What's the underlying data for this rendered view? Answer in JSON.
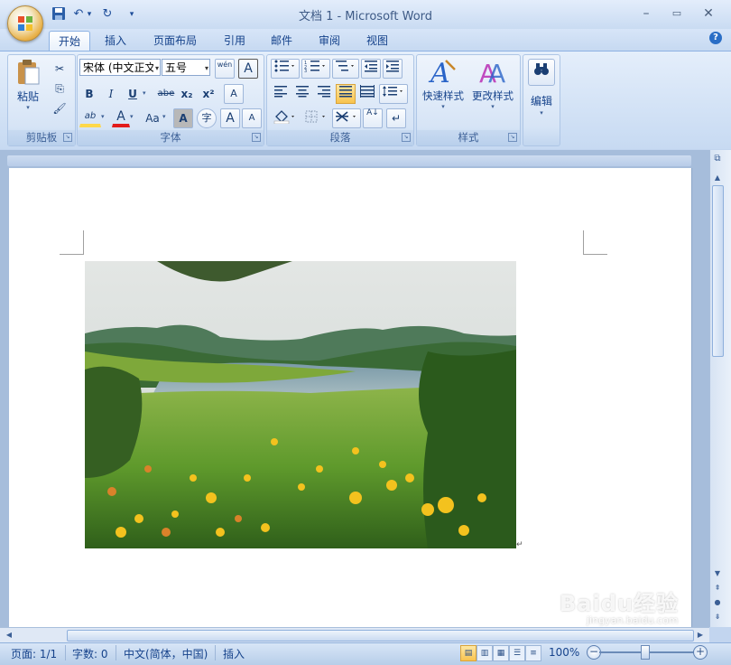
{
  "window": {
    "title": "文档 1 - Microsoft Word",
    "controls": {
      "minimize": "–",
      "maximize": "▭",
      "close": "✕"
    }
  },
  "quick_access": {
    "save": "💾",
    "undo": "↶",
    "undo_dropdown": "▾",
    "redo": "↻",
    "customize": "▾"
  },
  "tabs": [
    "开始",
    "插入",
    "页面布局",
    "引用",
    "邮件",
    "审阅",
    "视图"
  ],
  "active_tab": "开始",
  "help": "?",
  "ribbon": {
    "clipboard": {
      "label": "剪贴板",
      "paste": "粘贴",
      "cut": "✂",
      "copy": "⎘",
      "format_painter": "🖌"
    },
    "font": {
      "label": "字体",
      "font_name": "宋体 (中文正文)",
      "font_size": "五号",
      "phonetic": "wén",
      "char_border": "A",
      "bold": "B",
      "italic": "I",
      "underline": "U",
      "strike": "abe",
      "subscript": "x₂",
      "superscript": "x²",
      "clear_format": "A",
      "highlight": "ab",
      "font_color": "A",
      "change_case": "Aa",
      "char_shading": "A",
      "enclose": "字",
      "grow": "A",
      "shrink": "A"
    },
    "paragraph": {
      "label": "段落",
      "sort": "A↓",
      "show_marks": "↵"
    },
    "styles": {
      "label": "样式",
      "quick_styles": "快速样式",
      "change_styles": "更改样式"
    },
    "editing": {
      "label": "编辑"
    }
  },
  "status": {
    "page": "页面: 1/1",
    "words": "字数: 0",
    "language": "中文(简体，中国)",
    "mode": "插入",
    "zoom": "100%",
    "zoom_minus": "−",
    "zoom_plus": "+"
  },
  "watermark": {
    "logo": "Baidu经验",
    "url": "jingyan.baidu.com"
  },
  "colors": {
    "accent": "#15428b",
    "ribbon": "#c7daf2",
    "highlight": "#ffd84a",
    "font_color": "#e21b1b"
  }
}
